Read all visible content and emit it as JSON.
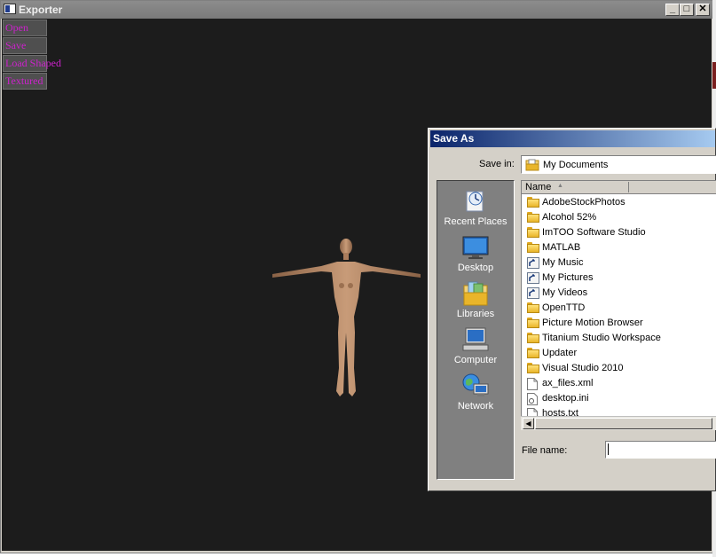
{
  "window": {
    "title": "Exporter",
    "controls": {
      "minimize": "_",
      "maximize": "□",
      "close": "✕"
    }
  },
  "menu": {
    "items": [
      {
        "label": "Open"
      },
      {
        "label": "Save"
      },
      {
        "label": "Load Shaped"
      },
      {
        "label": "Textured"
      }
    ],
    "text_color": "#cc22cc"
  },
  "viewport": {
    "background": "#1c1c1c",
    "model": "humanoid-figure"
  },
  "dialog": {
    "title": "Save As",
    "save_in_label": "Save in:",
    "save_in_value": "My Documents",
    "places": [
      {
        "label": "Recent Places",
        "icon": "recent-places-icon"
      },
      {
        "label": "Desktop",
        "icon": "desktop-icon"
      },
      {
        "label": "Libraries",
        "icon": "libraries-icon"
      },
      {
        "label": "Computer",
        "icon": "computer-icon"
      },
      {
        "label": "Network",
        "icon": "network-icon"
      }
    ],
    "list": {
      "column_name": "Name",
      "items": [
        {
          "name": "AdobeStockPhotos",
          "type": "folder"
        },
        {
          "name": "Alcohol 52%",
          "type": "folder"
        },
        {
          "name": "ImTOO Software Studio",
          "type": "folder"
        },
        {
          "name": "MATLAB",
          "type": "folder"
        },
        {
          "name": "My Music",
          "type": "shortcut"
        },
        {
          "name": "My Pictures",
          "type": "shortcut"
        },
        {
          "name": "My Videos",
          "type": "shortcut"
        },
        {
          "name": "OpenTTD",
          "type": "folder"
        },
        {
          "name": "Picture Motion Browser",
          "type": "folder"
        },
        {
          "name": "Titanium Studio Workspace",
          "type": "folder"
        },
        {
          "name": "Updater",
          "type": "folder"
        },
        {
          "name": "Visual Studio 2010",
          "type": "folder"
        },
        {
          "name": "ax_files.xml",
          "type": "file"
        },
        {
          "name": "desktop.ini",
          "type": "file-settings"
        },
        {
          "name": "hosts.txt",
          "type": "file"
        }
      ]
    },
    "file_name_label": "File name:",
    "file_name_value": ""
  }
}
